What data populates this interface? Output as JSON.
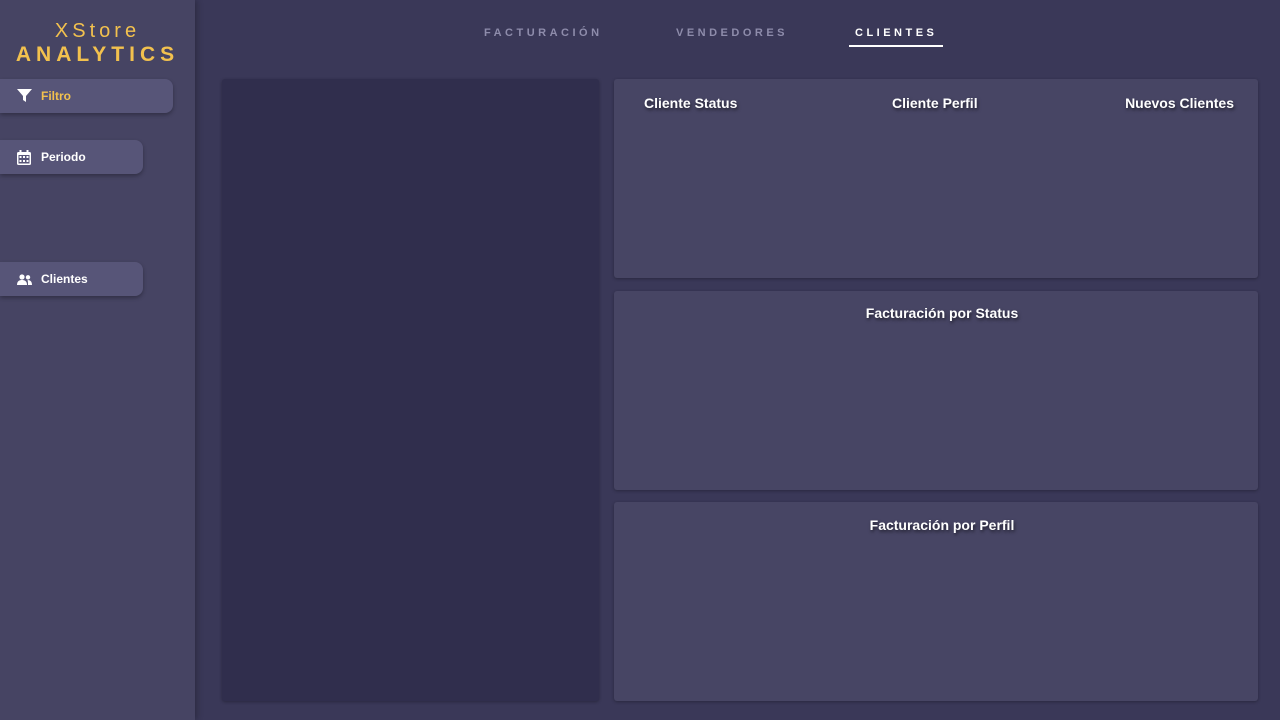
{
  "brand": {
    "line1": "XStore",
    "line2": "ANALYTICS",
    "color": "#f2c14e"
  },
  "sidebar": {
    "items": [
      {
        "label": "Filtro",
        "icon": "filter-icon"
      },
      {
        "label": "Periodo",
        "icon": "calendar-icon"
      },
      {
        "label": "Clientes",
        "icon": "users-icon"
      }
    ]
  },
  "tabs": [
    {
      "label": "FACTURACIÓN"
    },
    {
      "label": "VENDEDORES"
    },
    {
      "label": "CLIENTES",
      "active": true
    }
  ],
  "cards": {
    "top": {
      "titles": [
        "Cliente Status",
        "Cliente Perfil",
        "Nuevos Clientes"
      ]
    },
    "middle": {
      "title": "Facturación por Status"
    },
    "bottom": {
      "title": "Facturación por Perfil"
    }
  },
  "colors": {
    "background": "#3a3858",
    "sidebar": "#464463",
    "panel_dark": "#302e4d",
    "card": "#474564",
    "accent": "#f2c14e"
  }
}
